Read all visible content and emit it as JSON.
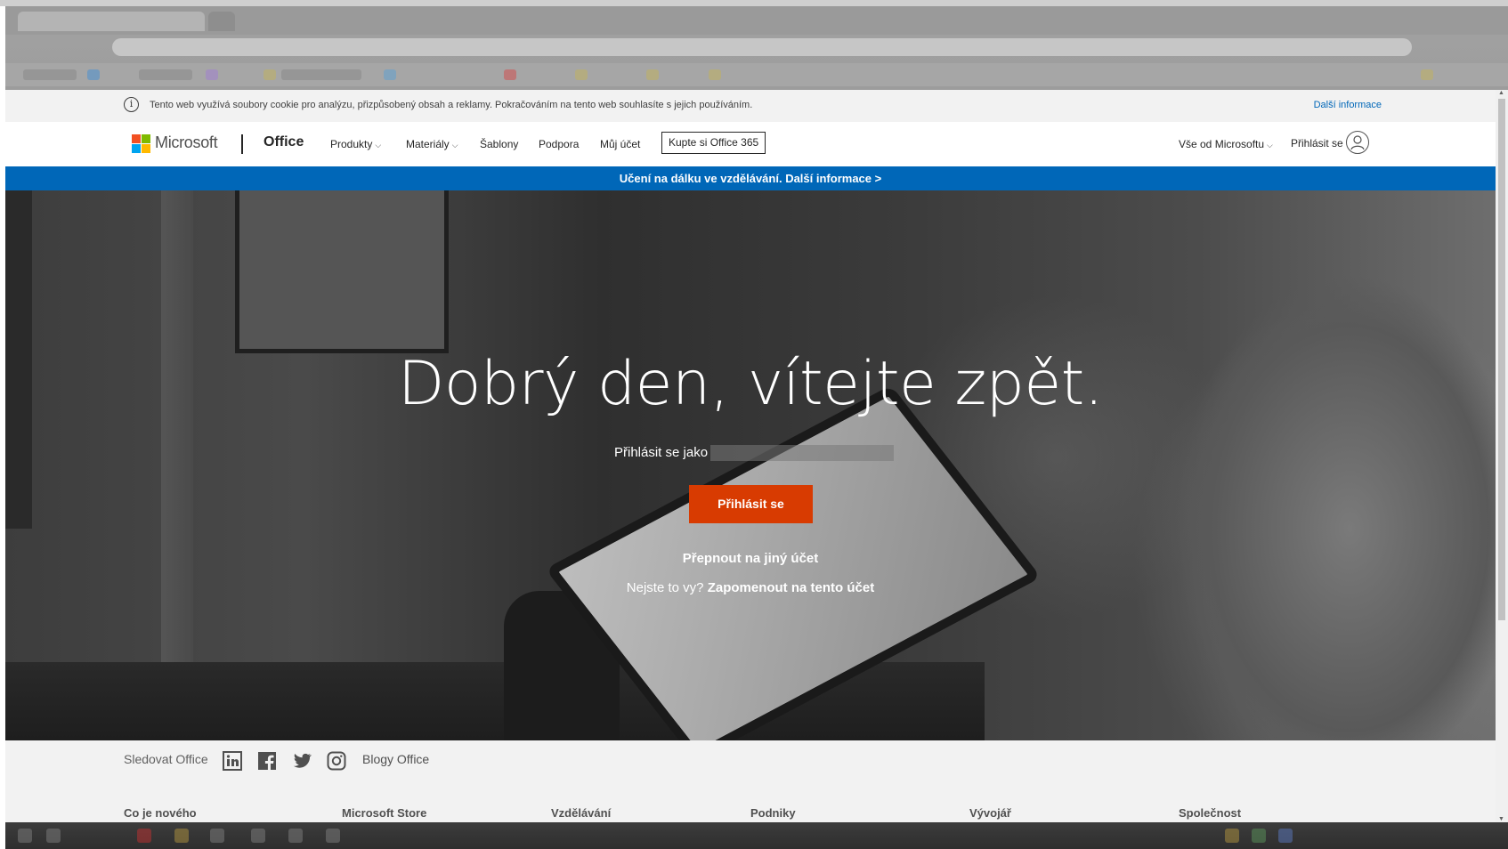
{
  "cookie_bar": {
    "text": "Tento web využívá soubory cookie pro analýzu, přizpůsobený obsah a reklamy. Pokračováním na tento web souhlasíte s jejich používáním.",
    "more_link": "Další informace",
    "icon": "info-icon"
  },
  "header": {
    "logo_text": "Microsoft",
    "brand": "Office",
    "nav": {
      "produkty": "Produkty",
      "materialy": "Materiály",
      "sablony": "Šablony",
      "podpora": "Podpora",
      "muj_ucet": "Můj účet"
    },
    "buy_button": "Kupte si Office 365",
    "all_microsoft": "Vše od Microsoftu",
    "sign_in": "Přihlásit se"
  },
  "banner": {
    "text": "Učení na dálku ve vzdělávání. Další informace >"
  },
  "hero": {
    "title": "Dobrý den, vítejte zpět.",
    "sign_in_as": "Přihlásit se jako",
    "sign_in_button": "Přihlásit se",
    "switch_account": "Přepnout na jiný účet",
    "not_you": "Nejste to vy?",
    "forget_account": "Zapomenout na tento účet"
  },
  "footer": {
    "follow": "Sledovat Office",
    "social_icons": [
      "linkedin-icon",
      "facebook-icon",
      "twitter-icon",
      "instagram-icon"
    ],
    "blog": "Blogy Office",
    "columns": [
      "Co je nového",
      "Microsoft Store",
      "Vzdělávání",
      "Podniky",
      "Vývojář",
      "Společnost"
    ]
  },
  "colors": {
    "accent_blue": "#0067b8",
    "signin_orange": "#d83b01",
    "ms_red": "#f25022",
    "ms_green": "#7fba00",
    "ms_blue": "#00a4ef",
    "ms_yellow": "#ffb900"
  }
}
